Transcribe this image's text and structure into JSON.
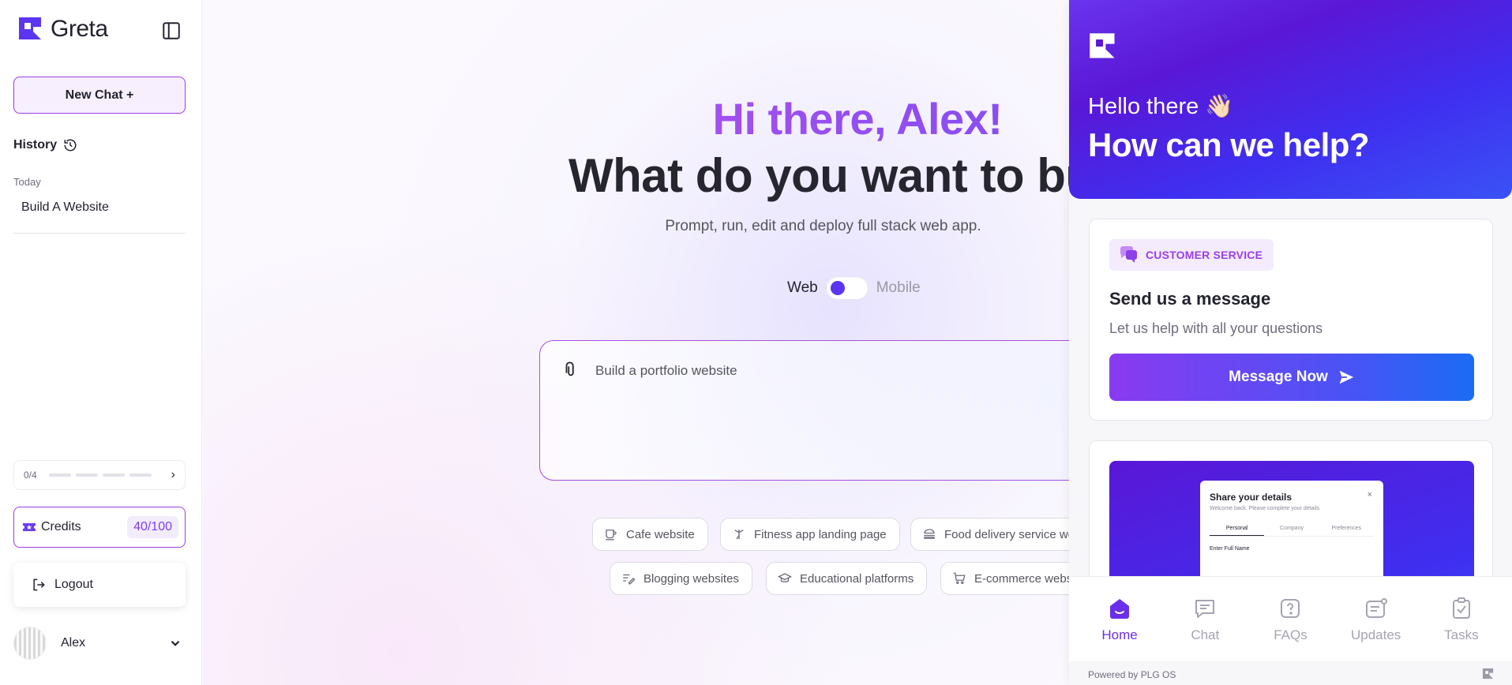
{
  "app": {
    "name": "Greta",
    "brand_color": "#5b35f0",
    "accent_color": "#9b3de8"
  },
  "sidebar": {
    "collapse_icon": "panel-left-icon",
    "new_chat_label": "New Chat +",
    "history_label": "History",
    "history_icon": "history-icon",
    "today_label": "Today",
    "history_items": [
      "Build A Website"
    ],
    "progress": {
      "text": "0/4",
      "completed": 0,
      "total": 4
    },
    "credits": {
      "label": "Credits",
      "count": "40/100",
      "icon": "ticket-icon"
    },
    "logout_label": "Logout",
    "user": {
      "name": "Alex"
    }
  },
  "main": {
    "greeting": "Hi there, Alex!",
    "headline": "What do you want to build today?",
    "subline": "Prompt, run, edit and deploy full stack web app.",
    "mode": {
      "web_label": "Web",
      "mobile_label": "Mobile",
      "selected": "Web"
    },
    "prompt": {
      "placeholder": "Build a portfolio website",
      "value": ""
    },
    "suggestions": [
      {
        "label": "Cafe website",
        "icon": "coffee-icon"
      },
      {
        "label": "Fitness app landing page",
        "icon": "fitness-icon"
      },
      {
        "label": "Food delivery service website",
        "icon": "burger-icon"
      },
      {
        "label": "Blogging websites",
        "icon": "pen-lines-icon"
      },
      {
        "label": "Educational platforms",
        "icon": "graduation-cap-icon"
      },
      {
        "label": "E-commerce websites",
        "icon": "cart-icon"
      }
    ]
  },
  "widget": {
    "hello": "Hello there 👋🏻",
    "headline": "How can we help?",
    "card": {
      "badge": "CUSTOMER SERVICE",
      "title": "Send us a message",
      "subtitle": "Let us help with all your questions",
      "button": "Message Now"
    },
    "preview": {
      "title": "Share your details",
      "subtitle": "Welcome back. Please complete your details",
      "close": "×",
      "tabs": [
        "Personal",
        "Company",
        "Preferences"
      ],
      "field": "Enter Full Name"
    },
    "nav": [
      {
        "label": "Home",
        "icon": "home-icon",
        "active": true
      },
      {
        "label": "Chat",
        "icon": "chat-icon",
        "active": false
      },
      {
        "label": "FAQs",
        "icon": "faq-icon",
        "active": false
      },
      {
        "label": "Updates",
        "icon": "updates-icon",
        "active": false
      },
      {
        "label": "Tasks",
        "icon": "tasks-icon",
        "active": false
      }
    ],
    "powered_by": "Powered by PLG OS"
  }
}
